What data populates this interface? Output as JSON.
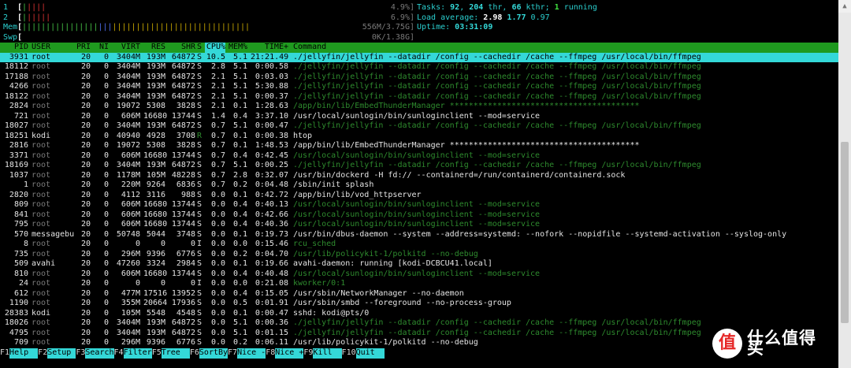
{
  "meters": [
    {
      "label": "1",
      "bar_open": "[",
      "bars": [
        {
          "t": "|",
          "c": "green"
        },
        {
          "t": "||||",
          "c": "red"
        }
      ],
      "value": "4.9%]",
      "label_color": "cyan"
    },
    {
      "label": "2",
      "bar_open": "[",
      "bars": [
        {
          "t": "|",
          "c": "green"
        },
        {
          "t": "|||||",
          "c": "red"
        }
      ],
      "value": "6.9%]",
      "label_color": "cyan"
    },
    {
      "label": "Mem",
      "bar_open": "[",
      "bars": [
        {
          "t": "||||||||||||||||",
          "c": "green"
        },
        {
          "t": "|||",
          "c": "blue"
        },
        {
          "t": "|||||||||||||||||||||||||||||",
          "c": "yel"
        }
      ],
      "value": "556M/3.75G]",
      "label_color": "cyan"
    },
    {
      "label": "Swp",
      "bar_open": "[",
      "bars": [],
      "value": "0K/1.38G]",
      "label_color": "cyan"
    }
  ],
  "stats": {
    "tasks_label": "Tasks: ",
    "tasks": "92",
    "thr": "204",
    "thr_label": " thr, ",
    "kthr": "66",
    "kthr_label": " kthr; ",
    "running": "1",
    "running_label": " running",
    "load_label": "Load average: ",
    "load1": "2.98",
    "load5": "1.77",
    "load15": "0.97",
    "uptime_label": "Uptime: ",
    "uptime": "03:31:09"
  },
  "columns": [
    "PID",
    "USER",
    "PRI",
    "NI",
    "VIRT",
    "RES",
    "SHR",
    "S",
    "CPU%",
    "MEM%",
    "TIME+",
    "Command"
  ],
  "sort_column": "CPU%",
  "processes": [
    {
      "pid": "3931",
      "user": "root",
      "pri": "20",
      "ni": "0",
      "virt": "3404M",
      "res": "193M",
      "shr": "64872",
      "s": "S",
      "cpu": "10.5",
      "mem": "5.1",
      "time": "21:21.49",
      "cmd": "./jellyfin/jellyfin --datadir /config --cachedir /cache --ffmpeg /usr/local/bin/ffmpeg",
      "thread": false,
      "selected": true
    },
    {
      "pid": "18112",
      "user": "root",
      "pri": "20",
      "ni": "0",
      "virt": "3404M",
      "res": "193M",
      "shr": "64872",
      "s": "S",
      "cpu": "2.8",
      "mem": "5.1",
      "time": "0:00.58",
      "cmd": "./jellyfin/jellyfin --datadir /config --cachedir /cache --ffmpeg /usr/local/bin/ffmpeg",
      "thread": true
    },
    {
      "pid": "17188",
      "user": "root",
      "pri": "20",
      "ni": "0",
      "virt": "3404M",
      "res": "193M",
      "shr": "64872",
      "s": "S",
      "cpu": "2.1",
      "mem": "5.1",
      "time": "0:03.03",
      "cmd": "./jellyfin/jellyfin --datadir /config --cachedir /cache --ffmpeg /usr/local/bin/ffmpeg",
      "thread": true
    },
    {
      "pid": "4266",
      "user": "root",
      "pri": "20",
      "ni": "0",
      "virt": "3404M",
      "res": "193M",
      "shr": "64872",
      "s": "S",
      "cpu": "2.1",
      "mem": "5.1",
      "time": "5:30.88",
      "cmd": "./jellyfin/jellyfin --datadir /config --cachedir /cache --ffmpeg /usr/local/bin/ffmpeg",
      "thread": true
    },
    {
      "pid": "18122",
      "user": "root",
      "pri": "20",
      "ni": "0",
      "virt": "3404M",
      "res": "193M",
      "shr": "64872",
      "s": "S",
      "cpu": "2.1",
      "mem": "5.1",
      "time": "0:00.37",
      "cmd": "./jellyfin/jellyfin --datadir /config --cachedir /cache --ffmpeg /usr/local/bin/ffmpeg",
      "thread": true
    },
    {
      "pid": "2824",
      "user": "root",
      "pri": "20",
      "ni": "0",
      "virt": "19072",
      "res": "5308",
      "shr": "3828",
      "s": "S",
      "cpu": "2.1",
      "mem": "0.1",
      "time": "1:28.63",
      "cmd": "/app/bin/lib/EmbedThunderManager ****************************************",
      "thread": true
    },
    {
      "pid": "721",
      "user": "root",
      "pri": "20",
      "ni": "0",
      "virt": "606M",
      "res": "16680",
      "shr": "13744",
      "s": "S",
      "cpu": "1.4",
      "mem": "0.4",
      "time": "3:37.10",
      "cmd": "/usr/local/sunlogin/bin/sunloginclient --mod=service",
      "thread": false
    },
    {
      "pid": "18027",
      "user": "root",
      "pri": "20",
      "ni": "0",
      "virt": "3404M",
      "res": "193M",
      "shr": "64872",
      "s": "S",
      "cpu": "0.7",
      "mem": "5.1",
      "time": "0:00.47",
      "cmd": "./jellyfin/jellyfin --datadir /config --cachedir /cache --ffmpeg /usr/local/bin/ffmpeg",
      "thread": true
    },
    {
      "pid": "18251",
      "user": "kodi",
      "pri": "20",
      "ni": "0",
      "virt": "40940",
      "res": "4928",
      "shr": "3708",
      "s": "R",
      "cpu": "0.7",
      "mem": "0.1",
      "time": "0:00.38",
      "cmd": "htop",
      "thread": false
    },
    {
      "pid": "2816",
      "user": "root",
      "pri": "20",
      "ni": "0",
      "virt": "19072",
      "res": "5308",
      "shr": "3828",
      "s": "S",
      "cpu": "0.7",
      "mem": "0.1",
      "time": "1:48.53",
      "cmd": "/app/bin/lib/EmbedThunderManager ****************************************",
      "thread": false
    },
    {
      "pid": "3371",
      "user": "root",
      "pri": "20",
      "ni": "0",
      "virt": "606M",
      "res": "16680",
      "shr": "13744",
      "s": "S",
      "cpu": "0.7",
      "mem": "0.4",
      "time": "0:42.45",
      "cmd": "/usr/local/sunlogin/bin/sunloginclient --mod=service",
      "thread": true
    },
    {
      "pid": "18169",
      "user": "root",
      "pri": "20",
      "ni": "0",
      "virt": "3404M",
      "res": "193M",
      "shr": "64872",
      "s": "S",
      "cpu": "0.7",
      "mem": "5.1",
      "time": "0:00.25",
      "cmd": "./jellyfin/jellyfin --datadir /config --cachedir /cache --ffmpeg /usr/local/bin/ffmpeg",
      "thread": true
    },
    {
      "pid": "1037",
      "user": "root",
      "pri": "20",
      "ni": "0",
      "virt": "1178M",
      "res": "105M",
      "shr": "48228",
      "s": "S",
      "cpu": "0.7",
      "mem": "2.8",
      "time": "0:32.07",
      "cmd": "/usr/bin/dockerd -H fd:// --containerd=/run/containerd/containerd.sock",
      "thread": false
    },
    {
      "pid": "1",
      "user": "root",
      "pri": "20",
      "ni": "0",
      "virt": "220M",
      "res": "9264",
      "shr": "6836",
      "s": "S",
      "cpu": "0.7",
      "mem": "0.2",
      "time": "0:04.48",
      "cmd": "/sbin/init splash",
      "thread": false
    },
    {
      "pid": "2820",
      "user": "root",
      "pri": "20",
      "ni": "0",
      "virt": "4112",
      "res": "3116",
      "shr": "988",
      "s": "S",
      "cpu": "0.0",
      "mem": "0.1",
      "time": "0:42.72",
      "cmd": "/app/bin/lib/vod_httpserver",
      "thread": false
    },
    {
      "pid": "809",
      "user": "root",
      "pri": "20",
      "ni": "0",
      "virt": "606M",
      "res": "16680",
      "shr": "13744",
      "s": "S",
      "cpu": "0.0",
      "mem": "0.4",
      "time": "0:40.13",
      "cmd": "/usr/local/sunlogin/bin/sunloginclient --mod=service",
      "thread": true
    },
    {
      "pid": "841",
      "user": "root",
      "pri": "20",
      "ni": "0",
      "virt": "606M",
      "res": "16680",
      "shr": "13744",
      "s": "S",
      "cpu": "0.0",
      "mem": "0.4",
      "time": "0:42.66",
      "cmd": "/usr/local/sunlogin/bin/sunloginclient --mod=service",
      "thread": true
    },
    {
      "pid": "795",
      "user": "root",
      "pri": "20",
      "ni": "0",
      "virt": "606M",
      "res": "16680",
      "shr": "13744",
      "s": "S",
      "cpu": "0.0",
      "mem": "0.4",
      "time": "0:40.36",
      "cmd": "/usr/local/sunlogin/bin/sunloginclient --mod=service",
      "thread": true
    },
    {
      "pid": "570",
      "user": "messagebu",
      "pri": "20",
      "ni": "0",
      "virt": "50748",
      "res": "5044",
      "shr": "3748",
      "s": "S",
      "cpu": "0.0",
      "mem": "0.1",
      "time": "0:19.73",
      "cmd": "/usr/bin/dbus-daemon --system --address=systemd: --nofork --nopidfile --systemd-activation --syslog-only",
      "thread": false
    },
    {
      "pid": "8",
      "user": "root",
      "pri": "20",
      "ni": "0",
      "virt": "0",
      "res": "0",
      "shr": "0",
      "s": "I",
      "cpu": "0.0",
      "mem": "0.0",
      "time": "0:15.46",
      "cmd": "rcu_sched",
      "thread": true
    },
    {
      "pid": "735",
      "user": "root",
      "pri": "20",
      "ni": "0",
      "virt": "296M",
      "res": "9396",
      "shr": "6776",
      "s": "S",
      "cpu": "0.0",
      "mem": "0.2",
      "time": "0:04.70",
      "cmd": "/usr/lib/policykit-1/polkitd --no-debug",
      "thread": true
    },
    {
      "pid": "509",
      "user": "avahi",
      "pri": "20",
      "ni": "0",
      "virt": "47260",
      "res": "3324",
      "shr": "2984",
      "s": "S",
      "cpu": "0.0",
      "mem": "0.1",
      "time": "0:19.66",
      "cmd": "avahi-daemon: running [kodi-DCBCU41.local]",
      "thread": false
    },
    {
      "pid": "810",
      "user": "root",
      "pri": "20",
      "ni": "0",
      "virt": "606M",
      "res": "16680",
      "shr": "13744",
      "s": "S",
      "cpu": "0.0",
      "mem": "0.4",
      "time": "0:40.48",
      "cmd": "/usr/local/sunlogin/bin/sunloginclient --mod=service",
      "thread": true
    },
    {
      "pid": "24",
      "user": "root",
      "pri": "20",
      "ni": "0",
      "virt": "0",
      "res": "0",
      "shr": "0",
      "s": "I",
      "cpu": "0.0",
      "mem": "0.0",
      "time": "0:21.08",
      "cmd": "kworker/0:1",
      "thread": true
    },
    {
      "pid": "612",
      "user": "root",
      "pri": "20",
      "ni": "0",
      "virt": "477M",
      "res": "17516",
      "shr": "13952",
      "s": "S",
      "cpu": "0.0",
      "mem": "0.4",
      "time": "0:15.05",
      "cmd": "/usr/sbin/NetworkManager --no-daemon",
      "thread": false
    },
    {
      "pid": "1190",
      "user": "root",
      "pri": "20",
      "ni": "0",
      "virt": "355M",
      "res": "20664",
      "shr": "17936",
      "s": "S",
      "cpu": "0.0",
      "mem": "0.5",
      "time": "0:01.91",
      "cmd": "/usr/sbin/smbd --foreground --no-process-group",
      "thread": false
    },
    {
      "pid": "28383",
      "user": "kodi",
      "pri": "20",
      "ni": "0",
      "virt": "105M",
      "res": "5548",
      "shr": "4548",
      "s": "S",
      "cpu": "0.0",
      "mem": "0.1",
      "time": "0:00.47",
      "cmd": "sshd: kodi@pts/0",
      "thread": false
    },
    {
      "pid": "18026",
      "user": "root",
      "pri": "20",
      "ni": "0",
      "virt": "3404M",
      "res": "193M",
      "shr": "64872",
      "s": "S",
      "cpu": "0.0",
      "mem": "5.1",
      "time": "0:00.36",
      "cmd": "./jellyfin/jellyfin --datadir /config --cachedir /cache --ffmpeg /usr/local/bin/ffmpeg",
      "thread": true
    },
    {
      "pid": "4795",
      "user": "root",
      "pri": "20",
      "ni": "0",
      "virt": "3404M",
      "res": "193M",
      "shr": "64872",
      "s": "S",
      "cpu": "0.0",
      "mem": "5.1",
      "time": "0:01.15",
      "cmd": "./jellyfin/jellyfin --datadir /config --cachedir /cache --ffmpeg /usr/local/bin/ffmpeg",
      "thread": true
    },
    {
      "pid": "709",
      "user": "root",
      "pri": "20",
      "ni": "0",
      "virt": "296M",
      "res": "9396",
      "shr": "6776",
      "s": "S",
      "cpu": "0.0",
      "mem": "0.2",
      "time": "0:06.11",
      "cmd": "/usr/lib/policykit-1/polkitd --no-debug",
      "thread": false
    }
  ],
  "footer": [
    {
      "key": "F1",
      "label": "Help  "
    },
    {
      "key": "F2",
      "label": "Setup "
    },
    {
      "key": "F3",
      "label": "Search"
    },
    {
      "key": "F4",
      "label": "Filter"
    },
    {
      "key": "F5",
      "label": "Tree  "
    },
    {
      "key": "F6",
      "label": "SortBy"
    },
    {
      "key": "F7",
      "label": "Nice -"
    },
    {
      "key": "F8",
      "label": "Nice +"
    },
    {
      "key": "F9",
      "label": "Kill  "
    },
    {
      "key": "F10",
      "label": "Quit  "
    }
  ],
  "watermark": {
    "logo": "值",
    "text": "什么值得买"
  },
  "colors": {
    "accent": "#34d8d8",
    "header_bg": "#1f9a1f",
    "thread_text": "#2e8b2e"
  }
}
